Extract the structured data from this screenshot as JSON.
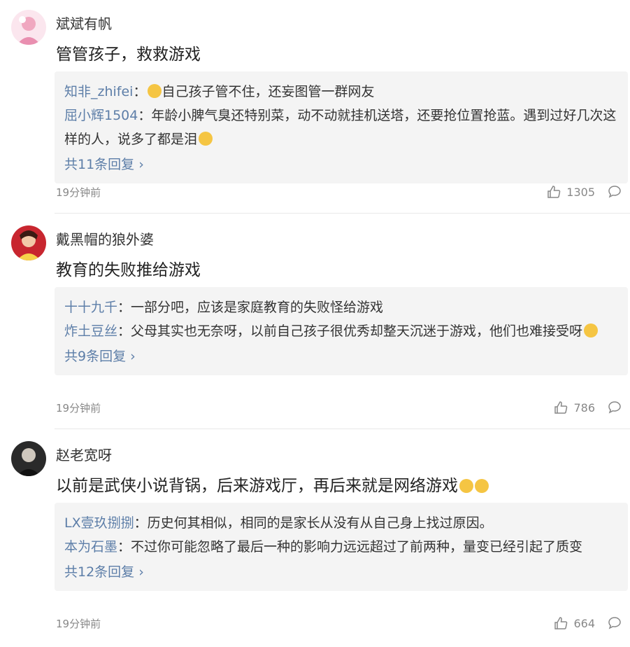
{
  "comments": [
    {
      "username": "斌斌有帆",
      "content": "管管孩子，救救游戏",
      "replies": [
        {
          "name": "知非_zhifei",
          "sep": "：",
          "text": "自己孩子管不住，还妄图管一群网友"
        },
        {
          "name": "屈小辉1504",
          "sep": "：",
          "text": "年龄小脾气臭还特别菜，动不动就挂机送塔，还要抢位置抢蓝。遇到过好几次这样的人，说多了都是泪"
        }
      ],
      "more": "共11条回复",
      "time": "19分钟前",
      "likes": "1305"
    },
    {
      "username": "戴黑帽的狼外婆",
      "content": "教育的失败推给游戏",
      "replies": [
        {
          "name": "十十九千",
          "sep": "：",
          "text": "一部分吧，应该是家庭教育的失败怪给游戏"
        },
        {
          "name": "炸土豆丝",
          "sep": "：",
          "text": "父母其实也无奈呀，以前自己孩子很优秀却整天沉迷于游戏，他们也难接受呀"
        }
      ],
      "more": "共9条回复",
      "time": "19分钟前",
      "likes": "786"
    },
    {
      "username": "赵老宽呀",
      "content": "以前是武侠小说背锅，后来游戏厅，再后来就是网络游戏",
      "replies": [
        {
          "name": "LX壹玖捌捌",
          "sep": "：",
          "text": "历史何其相似，相同的是家长从没有从自己身上找过原因。"
        },
        {
          "name": "本为石墨",
          "sep": "：",
          "text": "不过你可能忽略了最后一种的影响力远远超过了前两种，量变已经引起了质变"
        }
      ],
      "more": "共12条回复",
      "time": "19分钟前",
      "likes": "664"
    }
  ],
  "icons": {
    "like": "thumbs-up-icon",
    "comment": "comment-bubble-icon",
    "chevron": "chevron-right-icon"
  },
  "colors": {
    "link": "#5d7ea8",
    "reply_bg": "#f4f4f4",
    "meta": "#888888"
  }
}
